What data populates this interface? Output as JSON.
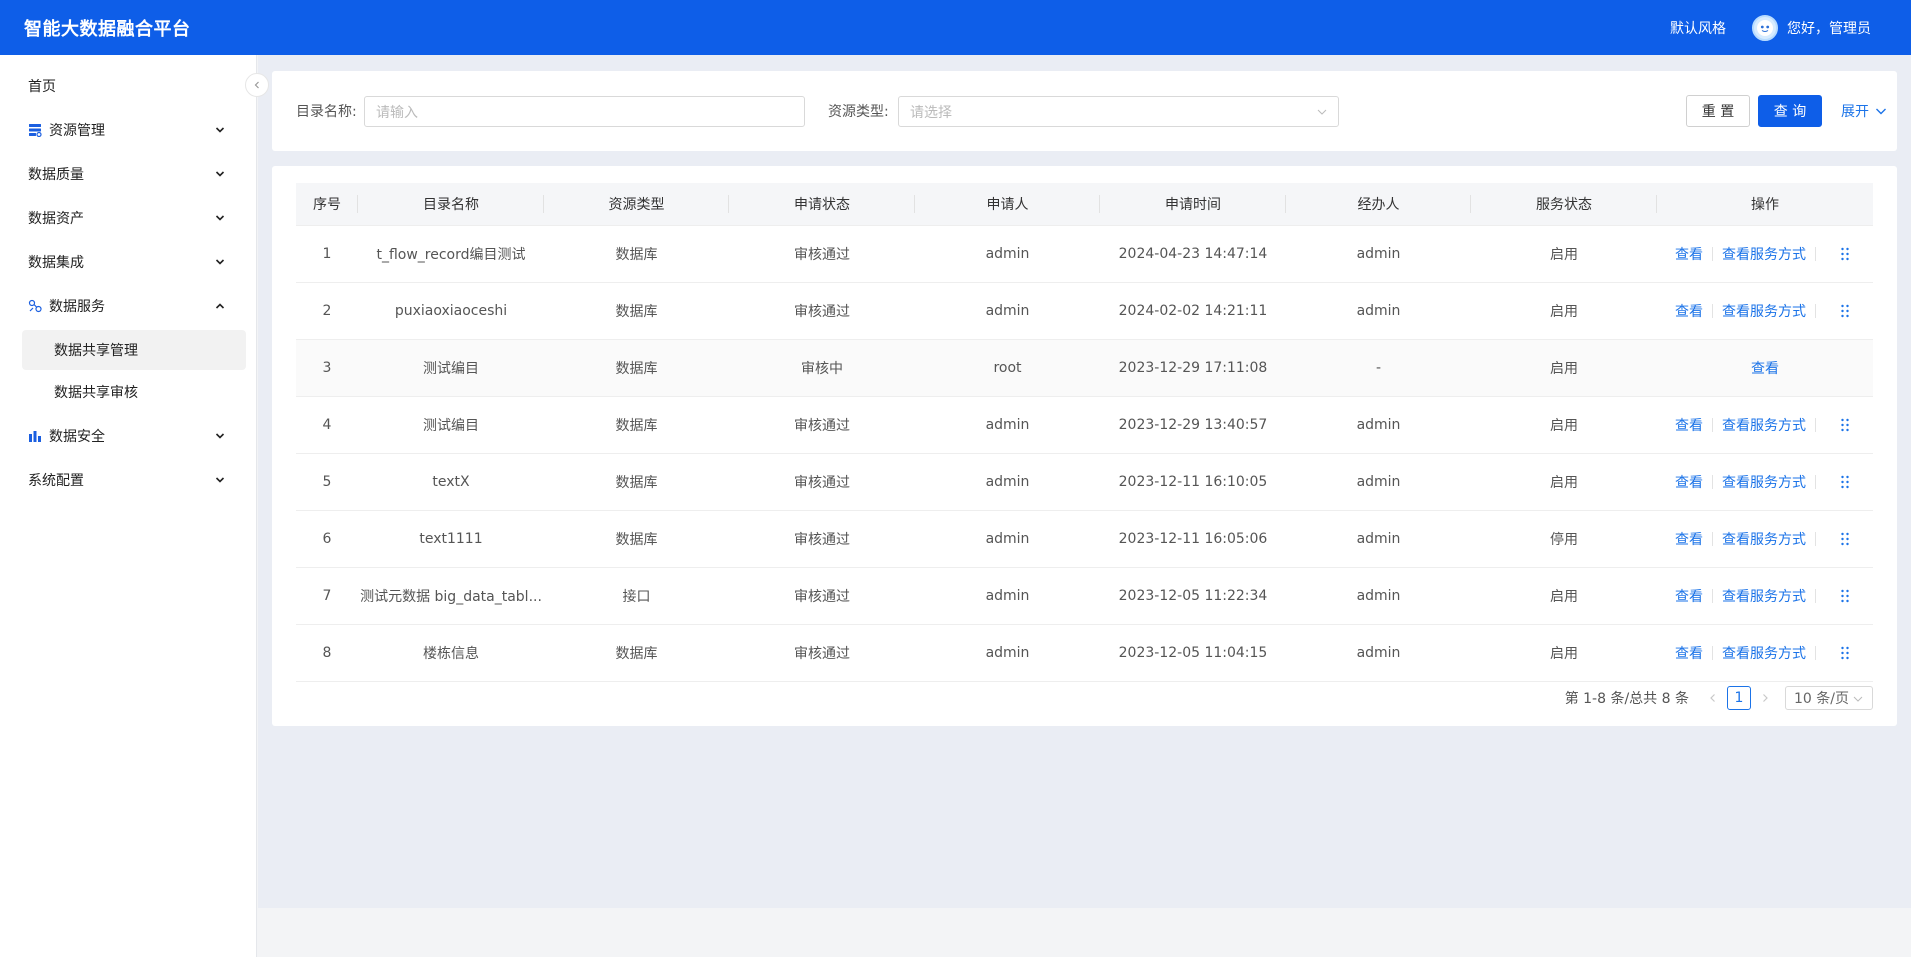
{
  "header": {
    "title": "智能大数据融合平台",
    "style_label": "默认风格",
    "greeting": "您好，管理员"
  },
  "sidebar": {
    "items": [
      {
        "label": "首页",
        "icon": "",
        "expanded": false
      },
      {
        "label": "资源管理",
        "icon": "resource-icon",
        "expanded": false
      },
      {
        "label": "数据质量",
        "icon": "",
        "expanded": false
      },
      {
        "label": "数据资产",
        "icon": "",
        "expanded": false
      },
      {
        "label": "数据集成",
        "icon": "",
        "expanded": false
      },
      {
        "label": "数据服务",
        "icon": "data-service-icon",
        "expanded": true,
        "children": [
          {
            "label": "数据共享管理",
            "active": true
          },
          {
            "label": "数据共享审核",
            "active": false
          }
        ]
      },
      {
        "label": "数据安全",
        "icon": "security-icon",
        "expanded": false
      },
      {
        "label": "系统配置",
        "icon": "",
        "expanded": false
      }
    ]
  },
  "search": {
    "name_label": "目录名称:",
    "name_placeholder": "请输入",
    "type_label": "资源类型:",
    "type_placeholder": "请选择",
    "reset_label": "重 置",
    "query_label": "查 询",
    "expand_label": "展开"
  },
  "table": {
    "columns": [
      "序号",
      "目录名称",
      "资源类型",
      "申请状态",
      "申请人",
      "申请时间",
      "经办人",
      "服务状态",
      "操作"
    ],
    "rows": [
      {
        "no": "1",
        "name": "t_flow_record编目测试",
        "type": "数据库",
        "status": "审核通过",
        "applicant": "admin",
        "time": "2024-04-23 14:47:14",
        "handler": "admin",
        "service": "启用",
        "full_ops": true
      },
      {
        "no": "2",
        "name": "puxiaoxiaoceshi",
        "type": "数据库",
        "status": "审核通过",
        "applicant": "admin",
        "time": "2024-02-02 14:21:11",
        "handler": "admin",
        "service": "启用",
        "full_ops": true
      },
      {
        "no": "3",
        "name": "测试编目",
        "type": "数据库",
        "status": "审核中",
        "applicant": "root",
        "time": "2023-12-29 17:11:08",
        "handler": "-",
        "service": "启用",
        "full_ops": false
      },
      {
        "no": "4",
        "name": "测试编目",
        "type": "数据库",
        "status": "审核通过",
        "applicant": "admin",
        "time": "2023-12-29 13:40:57",
        "handler": "admin",
        "service": "启用",
        "full_ops": true
      },
      {
        "no": "5",
        "name": "textX",
        "type": "数据库",
        "status": "审核通过",
        "applicant": "admin",
        "time": "2023-12-11 16:10:05",
        "handler": "admin",
        "service": "启用",
        "full_ops": true
      },
      {
        "no": "6",
        "name": "text1111",
        "type": "数据库",
        "status": "审核通过",
        "applicant": "admin",
        "time": "2023-12-11 16:05:06",
        "handler": "admin",
        "service": "停用",
        "full_ops": true
      },
      {
        "no": "7",
        "name": "测试元数据 big_data_tabl...",
        "type": "接口",
        "status": "审核通过",
        "applicant": "admin",
        "time": "2023-12-05 11:22:34",
        "handler": "admin",
        "service": "启用",
        "full_ops": true
      },
      {
        "no": "8",
        "name": "楼栋信息",
        "type": "数据库",
        "status": "审核通过",
        "applicant": "admin",
        "time": "2023-12-05 11:04:15",
        "handler": "admin",
        "service": "启用",
        "full_ops": true
      }
    ],
    "view_label": "查看",
    "view_service_label": "查看服务方式"
  },
  "pagination": {
    "summary": "第 1-8 条/总共 8 条",
    "current_page": "1",
    "page_size": "10 条/页"
  },
  "colors": {
    "primary": "#0e5ee8",
    "link": "#1b73e8"
  }
}
